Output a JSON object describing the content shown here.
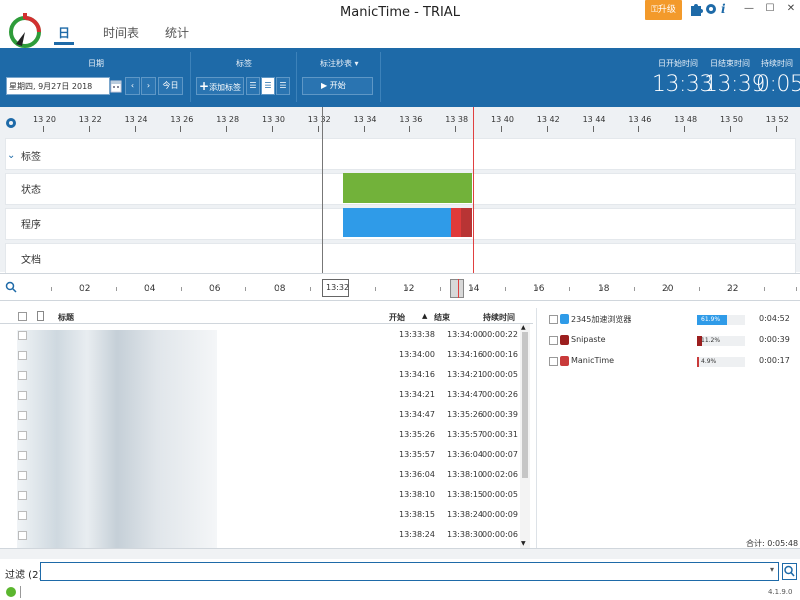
{
  "window": {
    "title": "ManicTime - TRIAL",
    "upgrade_label": "升级"
  },
  "nav_tabs": [
    {
      "label": "日",
      "active": true
    },
    {
      "label": "时间表",
      "active": false
    },
    {
      "label": "统计",
      "active": false
    }
  ],
  "toolbar": {
    "date_group_label": "日期",
    "date_value": "星期四, 9月27日 2018",
    "today_label": "今日",
    "tags_group_label": "标签",
    "add_tag_label": "添加标签",
    "tag_timer_label": "标注秒表 ▾",
    "start_label": "开始",
    "stats": [
      {
        "label": "日开始时间",
        "value": "13:33"
      },
      {
        "label": "日结束时间",
        "value": "13:39"
      },
      {
        "label": "持续时间",
        "value": "0:05"
      }
    ]
  },
  "timeline": {
    "ticks": [
      "13 20",
      "13 22",
      "13 24",
      "13 26",
      "13 28",
      "13 30",
      "13 32",
      "13 34",
      "13 36",
      "13 38",
      "13 40",
      "13 42",
      "13 44",
      "13 46",
      "13 48",
      "13 50",
      "13 52"
    ],
    "rows": [
      "标签",
      "状态",
      "程序",
      "文档"
    ],
    "colors": {
      "status_green": "#72b23a",
      "program_blue": "#2f9be8",
      "program_red": "#c93a3a",
      "current_line": "#e04040"
    }
  },
  "overview": {
    "labels": [
      "02",
      "04",
      "06",
      "08",
      "13:32",
      "12",
      "14",
      "16",
      "18",
      "20",
      "22"
    ]
  },
  "table": {
    "headers": {
      "title": "标题",
      "start": "开始",
      "end": "结束",
      "duration": "持续时间"
    },
    "rows": [
      {
        "start": "13:33:38",
        "end": "13:34:00",
        "duration": "00:00:22"
      },
      {
        "start": "13:34:00",
        "end": "13:34:16",
        "duration": "00:00:16"
      },
      {
        "start": "13:34:16",
        "end": "13:34:21",
        "duration": "00:00:05"
      },
      {
        "start": "13:34:21",
        "end": "13:34:47",
        "duration": "00:00:26"
      },
      {
        "start": "13:34:47",
        "end": "13:35:26",
        "duration": "00:00:39"
      },
      {
        "start": "13:35:26",
        "end": "13:35:57",
        "duration": "00:00:31"
      },
      {
        "start": "13:35:57",
        "end": "13:36:04",
        "duration": "00:00:07"
      },
      {
        "start": "13:36:04",
        "end": "13:38:10",
        "duration": "00:02:06"
      },
      {
        "start": "13:38:10",
        "end": "13:38:15",
        "duration": "00:00:05"
      },
      {
        "start": "13:38:15",
        "end": "13:38:24",
        "duration": "00:00:09"
      },
      {
        "start": "13:38:24",
        "end": "13:38:30",
        "duration": "00:00:06"
      }
    ]
  },
  "apps": [
    {
      "name": "2345加速浏览器",
      "percent_label": "61.9%",
      "percent": 61.9,
      "duration": "0:04:52",
      "color": "#2f9be8"
    },
    {
      "name": "Snipaste",
      "percent_label": "11.2%",
      "percent": 11.2,
      "duration": "0:00:39",
      "color": "#9c1f1f"
    },
    {
      "name": "ManicTime",
      "percent_label": "4.9%",
      "percent": 4.9,
      "duration": "0:00:17",
      "color": "#c93a3a"
    }
  ],
  "apps_total": "合计: 0:05:48",
  "filter": {
    "label": "过滤 (2)"
  },
  "version": "4.1.9.0"
}
